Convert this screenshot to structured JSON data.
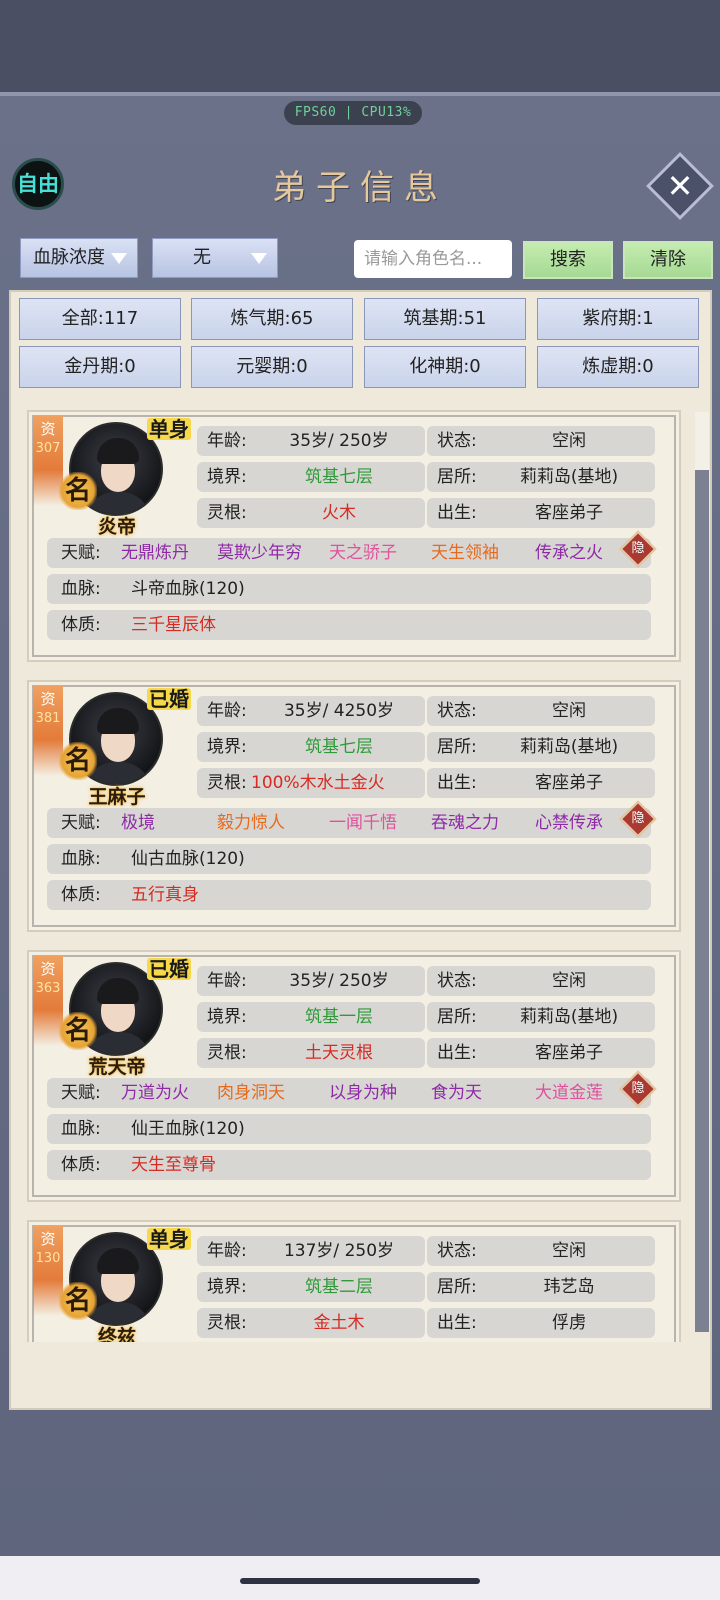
{
  "header": {
    "fps_text": "FPS60 | CPU13%",
    "mode_label": "自由",
    "title": "弟子信息"
  },
  "toolbar": {
    "dropdown1": "血脉浓度",
    "dropdown2": "无",
    "search_placeholder": "请输入角色名...",
    "search_button": "搜索",
    "clear_button": "清除"
  },
  "filters": [
    {
      "label": "全部:117"
    },
    {
      "label": "炼气期:65"
    },
    {
      "label": "筑基期:51"
    },
    {
      "label": "紫府期:1"
    },
    {
      "label": "金丹期:0"
    },
    {
      "label": "元婴期:0"
    },
    {
      "label": "化神期:0"
    },
    {
      "label": "炼虚期:0"
    }
  ],
  "labels": {
    "age": "年龄:",
    "state": "状态:",
    "realm": "境界:",
    "home": "居所:",
    "root": "灵根:",
    "birth": "出生:",
    "talent": "天赋:",
    "blood": "血脉:",
    "body": "体质:",
    "zi": "资",
    "ming": "名",
    "hide": "隐"
  },
  "disciples": [
    {
      "name": "炎帝",
      "aptitude": "307",
      "marital": "单身",
      "age": "35岁/ 250岁",
      "state": "空闲",
      "realm": "筑基七层",
      "home": "莉莉岛(基地)",
      "root": "火木",
      "birth": "客座弟子",
      "talents": [
        "无鼎炼丹",
        "莫欺少年穷",
        "天之骄子",
        "天生领袖",
        "传承之火"
      ],
      "talent_colors": [
        "c-purple",
        "c-purple",
        "c-pink",
        "c-orange",
        "c-purple"
      ],
      "bloodline": "斗帝血脉(120)",
      "physique": "三千星辰体"
    },
    {
      "name": "王麻子",
      "aptitude": "381",
      "marital": "已婚",
      "age": "35岁/ 4250岁",
      "state": "空闲",
      "realm": "筑基七层",
      "home": "莉莉岛(基地)",
      "root": "100%木水土金火",
      "birth": "客座弟子",
      "talents": [
        "极境",
        "毅力惊人",
        "一闻千悟",
        "吞魂之力",
        "心禁传承"
      ],
      "talent_colors": [
        "c-purple",
        "c-orange",
        "c-pink",
        "c-purple",
        "c-purple"
      ],
      "bloodline": "仙古血脉(120)",
      "physique": "五行真身"
    },
    {
      "name": "荒天帝",
      "aptitude": "363",
      "marital": "已婚",
      "age": "35岁/ 250岁",
      "state": "空闲",
      "realm": "筑基一层",
      "home": "莉莉岛(基地)",
      "root": "土天灵根",
      "birth": "客座弟子",
      "talents": [
        "万道为火",
        "肉身洞天",
        "以身为种",
        "食为天",
        "大道金莲"
      ],
      "talent_colors": [
        "c-purple",
        "c-orange",
        "c-purple",
        "c-purple",
        "c-pink"
      ],
      "bloodline": "仙王血脉(120)",
      "physique": "天生至尊骨"
    },
    {
      "name": "终兹",
      "aptitude": "130",
      "marital": "单身",
      "age": "137岁/ 250岁",
      "state": "空闲",
      "realm": "筑基二层",
      "home": "玮艺岛",
      "root": "金土木",
      "birth": "俘虏",
      "talents": [],
      "talent_colors": [],
      "bloodline": "",
      "physique": ""
    }
  ]
}
